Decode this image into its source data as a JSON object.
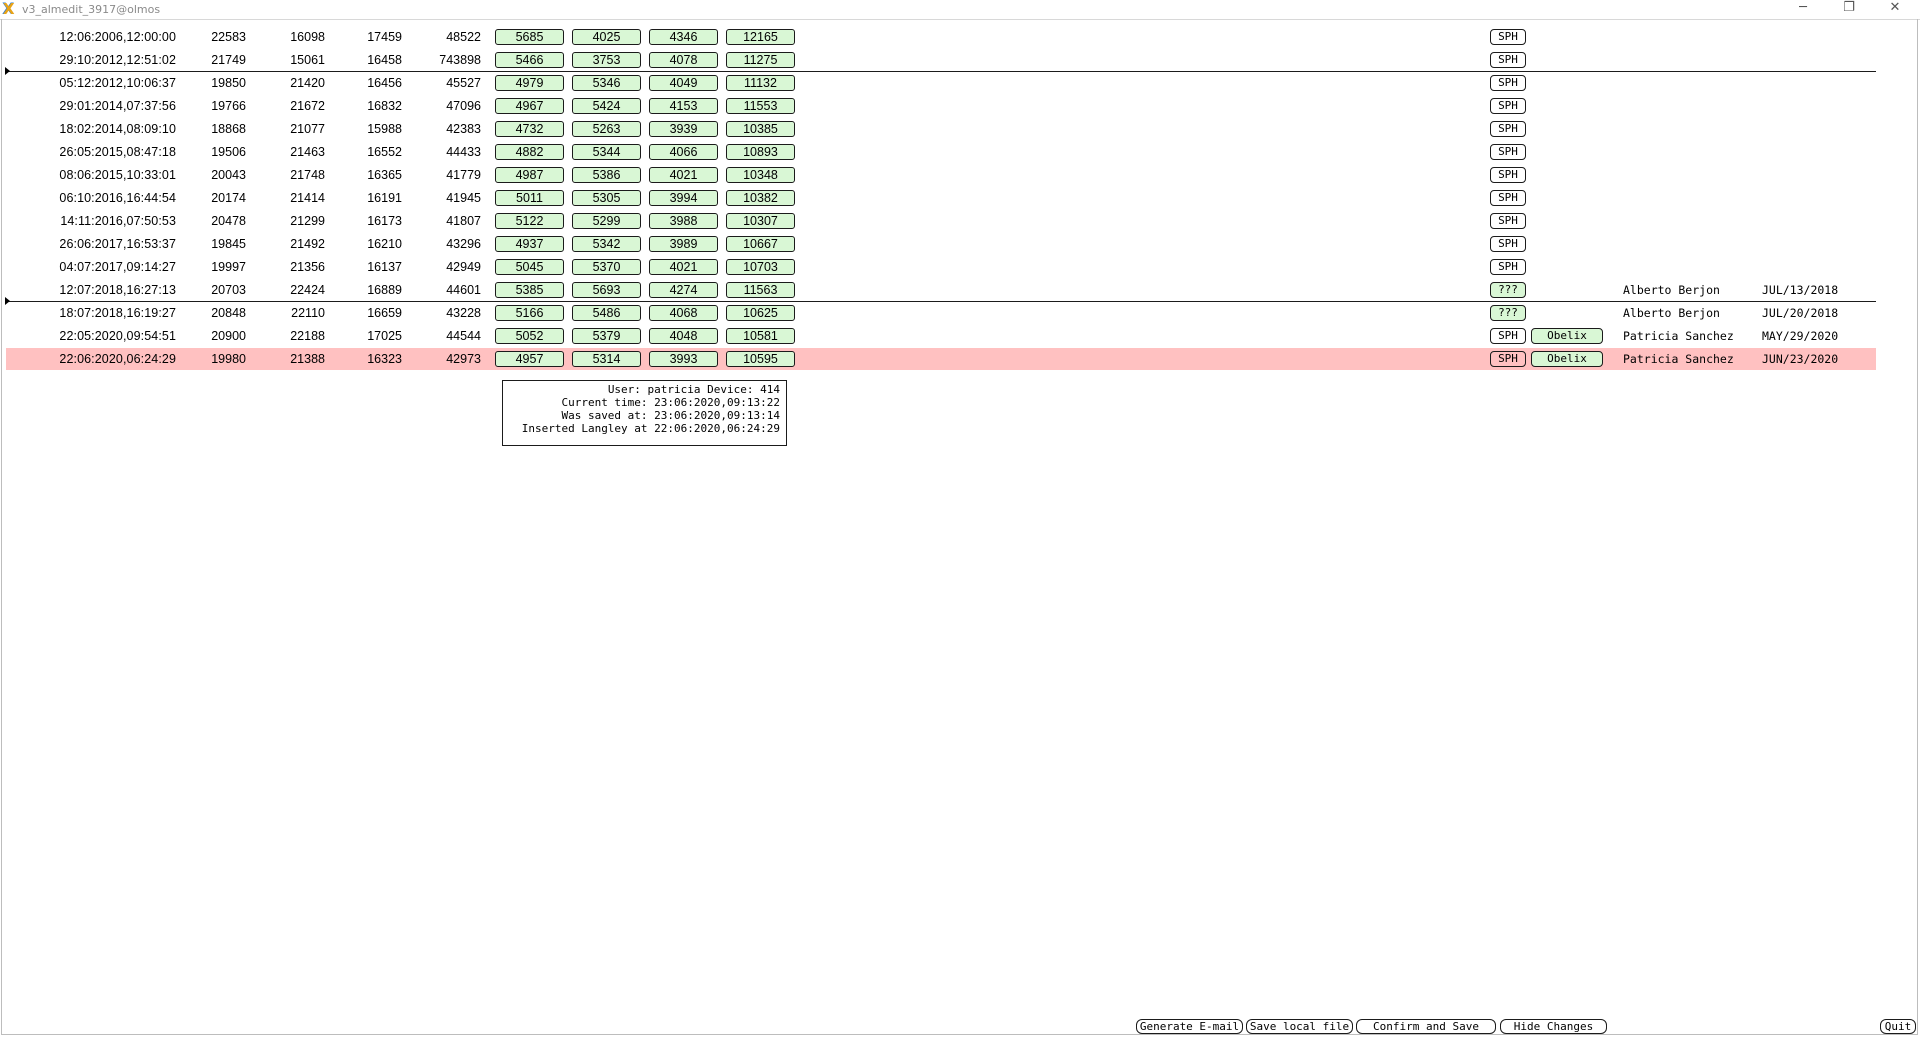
{
  "window": {
    "title": "v3_almedit_3917@olmos",
    "minimize_glyph": "─",
    "restore_glyph": "❐",
    "close_glyph": "✕"
  },
  "rows": [
    {
      "date": "12:06:2006,12:00:00",
      "n1": "22583",
      "n2": "16098",
      "n3": "17459",
      "n4": "48522",
      "g1": "5685",
      "g2": "4025",
      "g3": "4346",
      "g4": "12165",
      "sph": "SPH"
    },
    {
      "date": "29:10:2012,12:51:02",
      "n1": "21749",
      "n2": "15061",
      "n3": "16458",
      "n4": "743898",
      "g1": "5466",
      "g2": "3753",
      "g3": "4078",
      "g4": "11275",
      "sph": "SPH"
    },
    {
      "date": "05:12:2012,10:06:37",
      "n1": "19850",
      "n2": "21420",
      "n3": "16456",
      "n4": "45527",
      "g1": "4979",
      "g2": "5346",
      "g3": "4049",
      "g4": "11132",
      "sph": "SPH"
    },
    {
      "date": "29:01:2014,07:37:56",
      "n1": "19766",
      "n2": "21672",
      "n3": "16832",
      "n4": "47096",
      "g1": "4967",
      "g2": "5424",
      "g3": "4153",
      "g4": "11553",
      "sph": "SPH"
    },
    {
      "date": "18:02:2014,08:09:10",
      "n1": "18868",
      "n2": "21077",
      "n3": "15988",
      "n4": "42383",
      "g1": "4732",
      "g2": "5263",
      "g3": "3939",
      "g4": "10385",
      "sph": "SPH"
    },
    {
      "date": "26:05:2015,08:47:18",
      "n1": "19506",
      "n2": "21463",
      "n3": "16552",
      "n4": "44433",
      "g1": "4882",
      "g2": "5344",
      "g3": "4066",
      "g4": "10893",
      "sph": "SPH"
    },
    {
      "date": "08:06:2015,10:33:01",
      "n1": "20043",
      "n2": "21748",
      "n3": "16365",
      "n4": "41779",
      "g1": "4987",
      "g2": "5386",
      "g3": "4021",
      "g4": "10348",
      "sph": "SPH"
    },
    {
      "date": "06:10:2016,16:44:54",
      "n1": "20174",
      "n2": "21414",
      "n3": "16191",
      "n4": "41945",
      "g1": "5011",
      "g2": "5305",
      "g3": "3994",
      "g4": "10382",
      "sph": "SPH"
    },
    {
      "date": "14:11:2016,07:50:53",
      "n1": "20478",
      "n2": "21299",
      "n3": "16173",
      "n4": "41807",
      "g1": "5122",
      "g2": "5299",
      "g3": "3988",
      "g4": "10307",
      "sph": "SPH"
    },
    {
      "date": "26:06:2017,16:53:37",
      "n1": "19845",
      "n2": "21492",
      "n3": "16210",
      "n4": "43296",
      "g1": "4937",
      "g2": "5342",
      "g3": "3989",
      "g4": "10667",
      "sph": "SPH"
    },
    {
      "date": "04:07:2017,09:14:27",
      "n1": "19997",
      "n2": "21356",
      "n3": "16137",
      "n4": "42949",
      "g1": "5045",
      "g2": "5370",
      "g3": "4021",
      "g4": "10703",
      "sph": "SPH"
    },
    {
      "date": "12:07:2018,16:27:13",
      "n1": "20703",
      "n2": "22424",
      "n3": "16889",
      "n4": "44601",
      "g1": "5385",
      "g2": "5693",
      "g3": "4274",
      "g4": "11563",
      "sph": "???",
      "user": "Alberto Berjon",
      "udate": "JUL/13/2018"
    },
    {
      "date": "18:07:2018,16:19:27",
      "n1": "20848",
      "n2": "22110",
      "n3": "16659",
      "n4": "43228",
      "g1": "5166",
      "g2": "5486",
      "g3": "4068",
      "g4": "10625",
      "sph": "???",
      "user": "Alberto Berjon",
      "udate": "JUL/20/2018"
    },
    {
      "date": "22:05:2020,09:54:51",
      "n1": "20900",
      "n2": "22188",
      "n3": "17025",
      "n4": "44544",
      "g1": "5052",
      "g2": "5379",
      "g3": "4048",
      "g4": "10581",
      "sph": "SPH",
      "obelix": "Obelix",
      "user": "Patricia Sanchez",
      "udate": "MAY/29/2020"
    },
    {
      "date": "22:06:2020,06:24:29",
      "n1": "19980",
      "n2": "21388",
      "n3": "16323",
      "n4": "42973",
      "g1": "4957",
      "g2": "5314",
      "g3": "3993",
      "g4": "10595",
      "sph": "SPH",
      "obelix": "Obelix",
      "user": "Patricia Sanchez",
      "udate": "JUN/23/2020",
      "selected": true
    }
  ],
  "info": {
    "line1": "User: patricia Device: 414",
    "line2": "Current time: 23:06:2020,09:13:22",
    "line3": "Was saved at: 23:06:2020,09:13:14",
    "line4": "Inserted Langley at 22:06:2020,06:24:29"
  },
  "buttons": {
    "generate_email": "Generate E-mail",
    "save_local": "Save local file",
    "confirm_save": "Confirm and Save",
    "hide_changes": "Hide Changes",
    "quit": "Quit"
  }
}
